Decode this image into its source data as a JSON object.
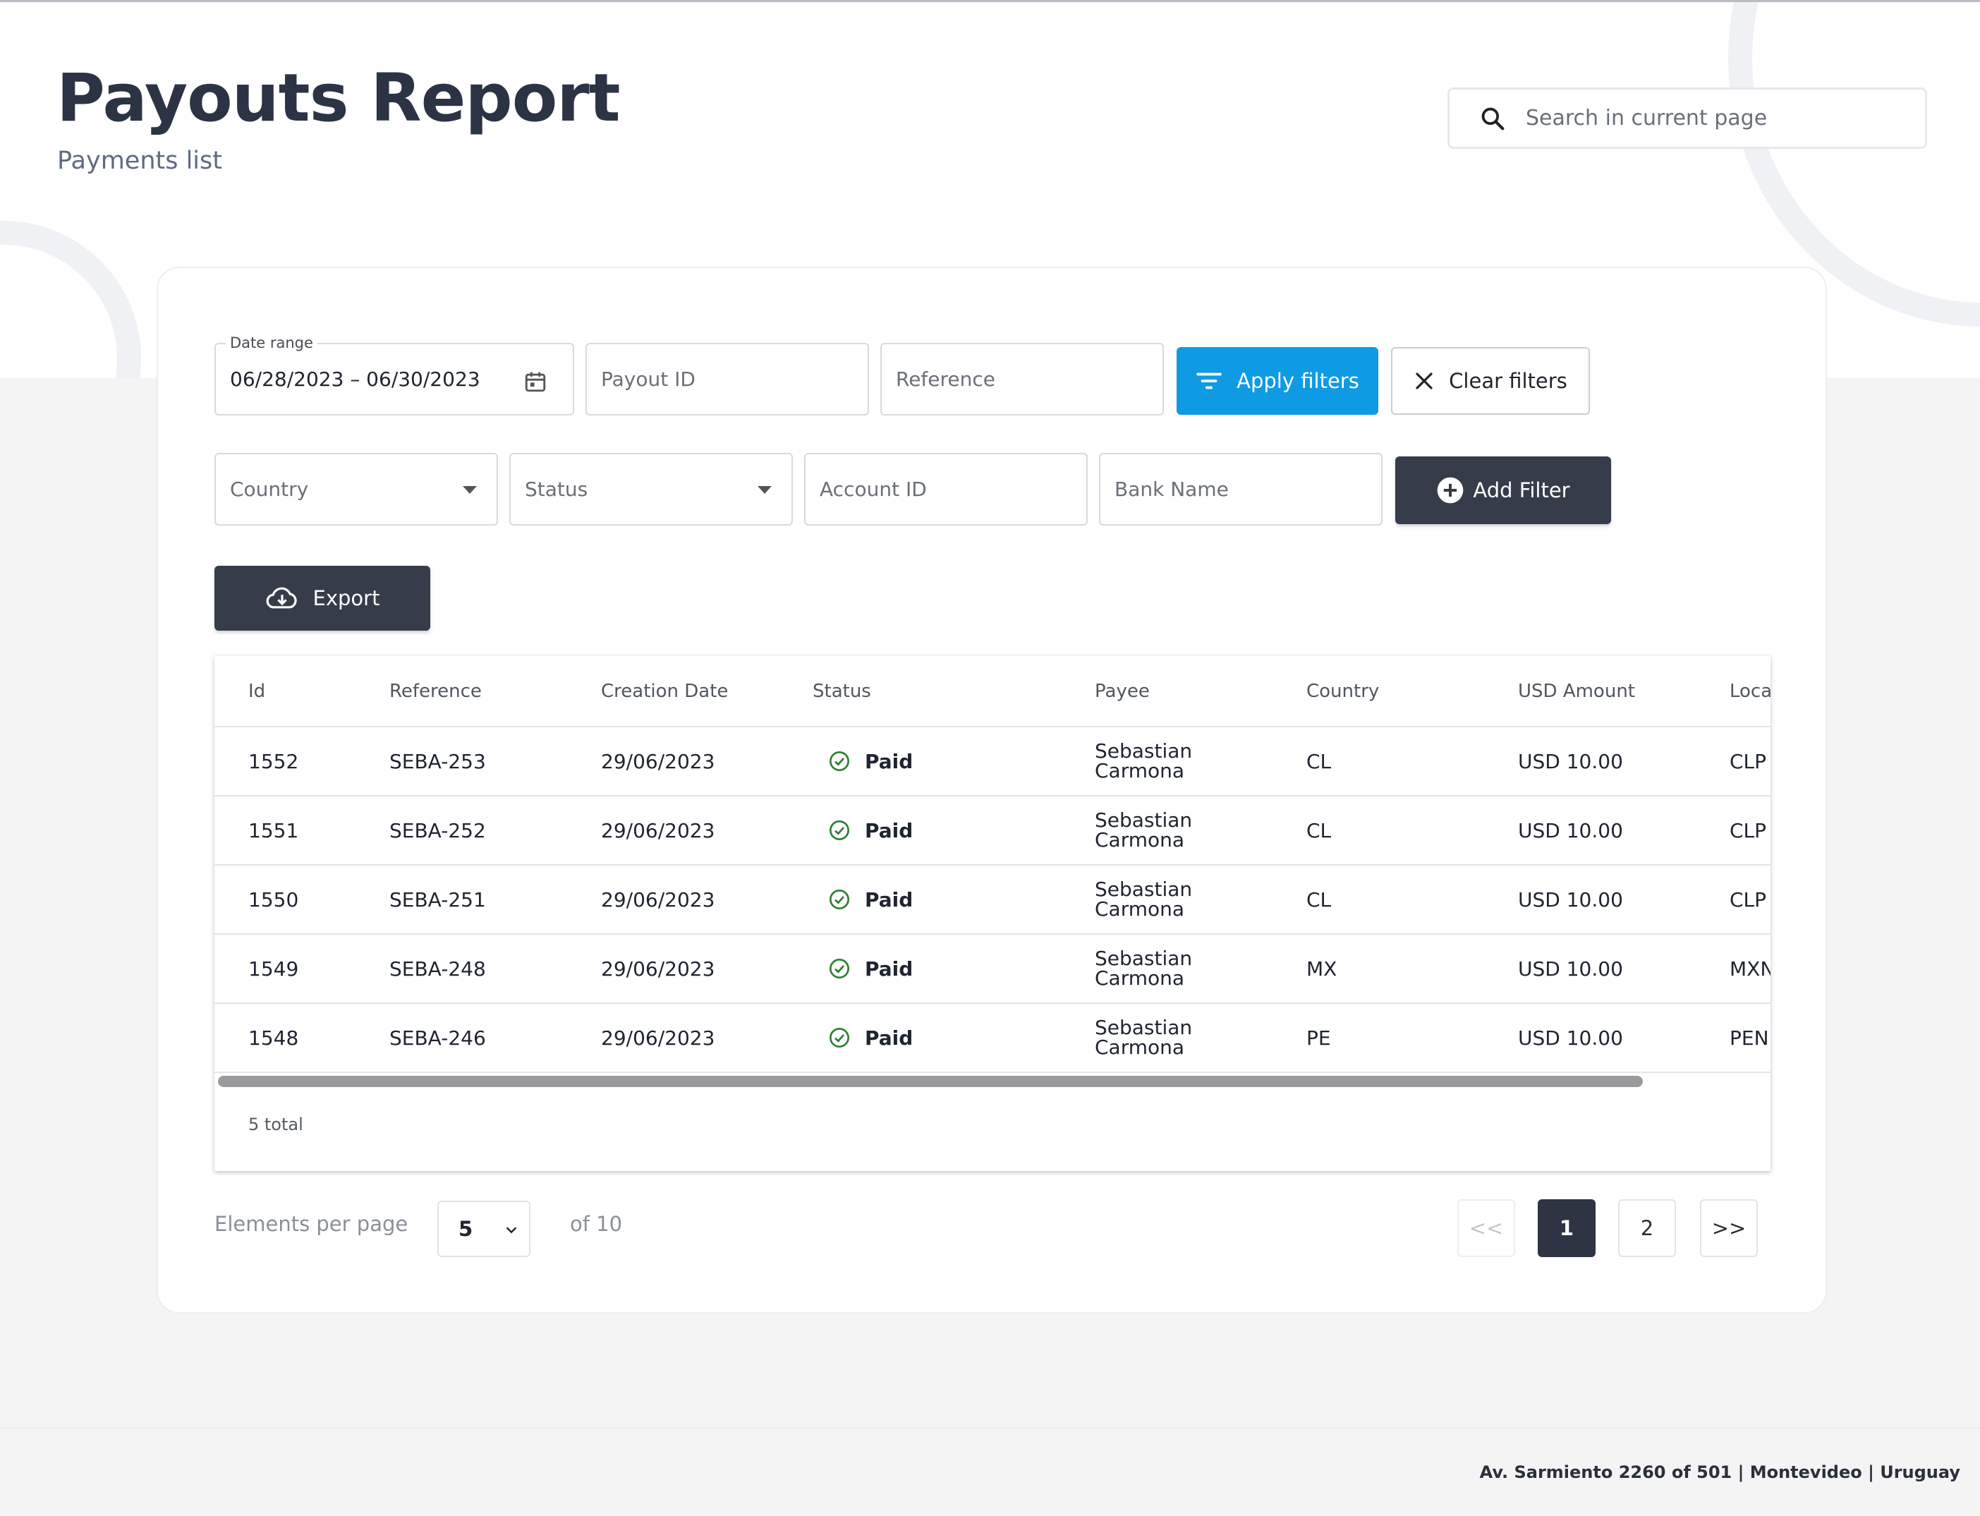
{
  "header": {
    "title": "Payouts Report",
    "subtitle": "Payments list",
    "search_placeholder": "Search in current page"
  },
  "filters": {
    "date_range": {
      "label": "Date range",
      "value": "06/28/2023 – 06/30/2023"
    },
    "payout_id_placeholder": "Payout ID",
    "reference_placeholder": "Reference",
    "apply_label": "Apply filters",
    "clear_label": "Clear filters",
    "country_placeholder": "Country",
    "status_placeholder": "Status",
    "account_id_placeholder": "Account ID",
    "bank_name_placeholder": "Bank Name",
    "add_filter_label": "Add Filter",
    "export_label": "Export"
  },
  "table": {
    "columns": [
      "Id",
      "Reference",
      "Creation Date",
      "Status",
      "Payee",
      "Country",
      "USD Amount",
      "Loca"
    ],
    "rows": [
      {
        "id": "1552",
        "reference": "SEBA-253",
        "date": "29/06/2023",
        "status": "Paid",
        "payee_first": "Sebastian",
        "payee_last": "Carmona",
        "country": "CL",
        "usd": "USD 10.00",
        "local": "CLP"
      },
      {
        "id": "1551",
        "reference": "SEBA-252",
        "date": "29/06/2023",
        "status": "Paid",
        "payee_first": "Sebastian",
        "payee_last": "Carmona",
        "country": "CL",
        "usd": "USD 10.00",
        "local": "CLP"
      },
      {
        "id": "1550",
        "reference": "SEBA-251",
        "date": "29/06/2023",
        "status": "Paid",
        "payee_first": "Sebastian",
        "payee_last": "Carmona",
        "country": "CL",
        "usd": "USD 10.00",
        "local": "CLP"
      },
      {
        "id": "1549",
        "reference": "SEBA-248",
        "date": "29/06/2023",
        "status": "Paid",
        "payee_first": "Sebastian",
        "payee_last": "Carmona",
        "country": "MX",
        "usd": "USD 10.00",
        "local": "MXN"
      },
      {
        "id": "1548",
        "reference": "SEBA-246",
        "date": "29/06/2023",
        "status": "Paid",
        "payee_first": "Sebastian",
        "payee_last": "Carmona",
        "country": "PE",
        "usd": "USD 10.00",
        "local": "PEN"
      }
    ],
    "total_label": "5 total"
  },
  "pagination": {
    "per_page_label": "Elements per page",
    "per_page_value": "5",
    "of_label": "of 10",
    "first_label": "<<",
    "pages": [
      "1",
      "2"
    ],
    "current_page": "1",
    "last_label": ">>"
  },
  "footer": {
    "address": "Av. Sarmiento 2260 of 501 | Montevideo | Uruguay"
  },
  "colors": {
    "primary": "#0f9be3",
    "dark_button": "#363c4a",
    "success": "#2e7d32",
    "title": "#2c3344"
  }
}
